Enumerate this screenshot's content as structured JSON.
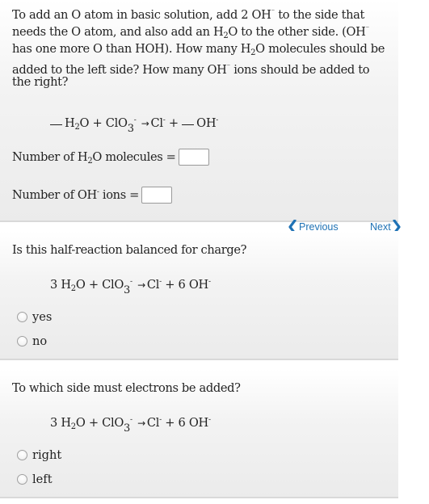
{
  "panel1": {
    "instruction_lines": [
      [
        "To add an O atom in basic solution, add 2 OH",
        "⁻",
        " to the side that"
      ],
      [
        "needs the O atom, and also add an H",
        "2",
        "O to the other side. (OH",
        "⁻"
      ],
      [
        "has one more O than HOH). How many H",
        "2",
        "O molecules should be"
      ],
      [
        "added to the left side? How many OH",
        "⁻",
        " ions should be added to"
      ],
      [
        "the right?"
      ]
    ],
    "equation": {
      "blank_left": "",
      "h2o": "H",
      "h2o_sub": "2",
      "h2o_tail": "O",
      "plus1": "+",
      "clo3": "ClO",
      "clo3_sub": "3",
      "clo3_charge": "-",
      "arrow": "→",
      "cl": "Cl",
      "cl_charge": "-",
      "plus2": "+",
      "blank_right": "",
      "oh": "OH",
      "oh_charge": "-"
    },
    "fields": {
      "h2o_label_pre": "Number of H",
      "h2o_label_sub": "2",
      "h2o_label_post": "O molecules =",
      "h2o_value": "",
      "oh_label_pre": "Number of OH",
      "oh_label_sup": "-",
      "oh_label_post": " ions =",
      "oh_value": ""
    }
  },
  "nav": {
    "previous_label": "Previous",
    "next_label": "Next",
    "accent_color": "#1f72b5"
  },
  "panel2": {
    "question": "Is this half-reaction balanced for charge?",
    "equation": {
      "coef1": "3",
      "h2o": "H",
      "h2o_sub": "2",
      "h2o_tail": "O",
      "plus1": "+",
      "clo3": "ClO",
      "clo3_sub": "3",
      "clo3_charge": "-",
      "arrow": "→",
      "cl": "Cl",
      "cl_charge": "-",
      "plus2": "+",
      "coef2": "6",
      "oh": "OH",
      "oh_charge": "-"
    },
    "options": [
      "yes",
      "no"
    ]
  },
  "panel3": {
    "question": "To which side must electrons be added?",
    "equation": {
      "coef1": "3",
      "h2o": "H",
      "h2o_sub": "2",
      "h2o_tail": "O",
      "plus1": "+",
      "clo3": "ClO",
      "clo3_sub": "3",
      "clo3_charge": "-",
      "arrow": "→",
      "cl": "Cl",
      "cl_charge": "-",
      "plus2": "+",
      "coef2": "6",
      "oh": "OH",
      "oh_charge": "-"
    },
    "options": [
      "right",
      "left"
    ]
  }
}
